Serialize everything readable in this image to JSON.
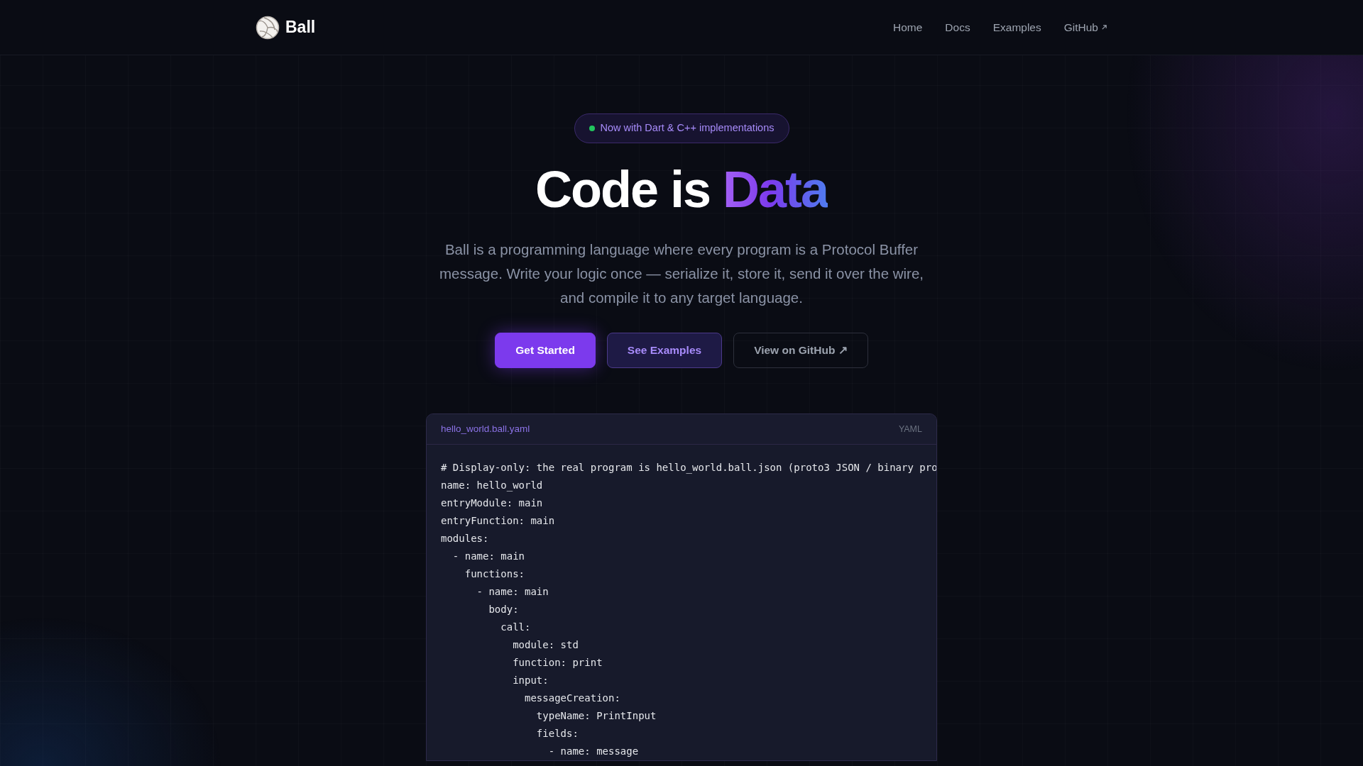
{
  "brand": {
    "name": "Ball"
  },
  "nav": [
    {
      "label": "Home",
      "external": false
    },
    {
      "label": "Docs",
      "external": false
    },
    {
      "label": "Examples",
      "external": false
    },
    {
      "label": "GitHub",
      "external": true
    }
  ],
  "announcement": {
    "text": "Now with Dart & C++ implementations",
    "color": "#22c55e"
  },
  "hero": {
    "title": "Code is",
    "highlight": "Data",
    "description": "Ball is a programming language where every program is a Protocol Buffer message. Write your logic once — serialize it, store it, send it over the wire, and compile it to any target language."
  },
  "buttons": [
    {
      "label": "Get Started",
      "kind": "primary"
    },
    {
      "label": "See Examples",
      "kind": "secondary"
    },
    {
      "label": "View on GitHub ↗",
      "kind": "outline"
    }
  ],
  "code": {
    "filename": "hello_world.ball.yaml",
    "language": "YAML",
    "lines": [
      "# Display-only: the real program is hello_world.ball.json (proto3 JSON / binary pro",
      "name: hello_world",
      "entryModule: main",
      "entryFunction: main",
      "modules:",
      "  - name: main",
      "    functions:",
      "      - name: main",
      "        body:",
      "          call:",
      "            module: std",
      "            function: print",
      "            input:",
      "              messageCreation:",
      "                typeName: PrintInput",
      "                fields:",
      "                  - name: message"
    ]
  }
}
